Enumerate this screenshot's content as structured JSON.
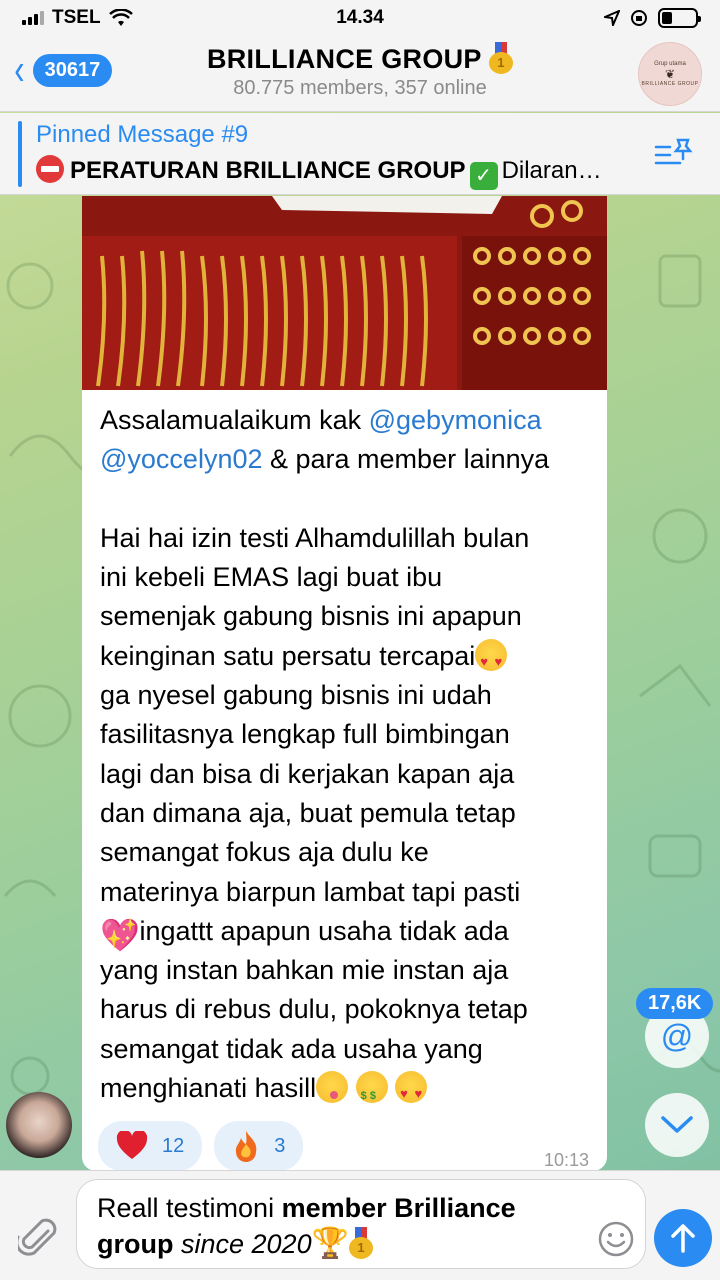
{
  "status_bar": {
    "carrier": "TSEL",
    "time": "14.34"
  },
  "header": {
    "back_badge": "30617",
    "title": "BRILLIANCE GROUP",
    "subtitle": "80.775 members, 357 online",
    "avatar_text_top": "Grup utama",
    "avatar_text_bottom": "BRILLIANCE GROUP"
  },
  "pinned": {
    "title": "Pinned Message #9",
    "text_bold": "PERATURAN BRILLIANCE GROUP",
    "text_rest": "Dilaran…"
  },
  "message": {
    "greeting": "Assalamualaikum kak ",
    "mention_1": "@gebymonica",
    "mention_2": "@yoccelyn02",
    "greeting_rest": " & para member lainnya",
    "body_1": "Hai hai izin testi Alhamdulillah bulan\nini kebeli EMAS lagi buat ibu\nsemenjak gabung bisnis ini apapun\nkeinginan satu persatu tercapai",
    "body_2": "ga nyesel gabung bisnis ini udah\nfasilitasnya lengkap full bimbingan\nlagi dan bisa di kerjakan kapan aja\ndan dimana aja, buat pemula tetap\nsemangat fokus aja dulu ke\nmaterinya biarpun lambat tapi pasti\n",
    "body_3": " ingattt apapun usaha tidak ada\nyang instan bahkan mie instan aja\nharus di rebus dulu, pokoknya tetap\nsemangat tidak ada usaha yang\nmenghianati hasill",
    "time": "10:13"
  },
  "reactions": [
    {
      "icon": "heart-icon",
      "count": "12"
    },
    {
      "icon": "fire-icon",
      "count": "3"
    }
  ],
  "floating": {
    "mention_count": "17,6K",
    "mention_symbol": "@"
  },
  "input": {
    "text_1": "Reall testimoni ",
    "text_bold": "member Brilliance",
    "text_bold_2": "group",
    "text_italic": " since 2020"
  },
  "colors": {
    "accent": "#2a8bf2",
    "mention": "#2a7ad0",
    "reaction_bg": "#e5f0fb"
  }
}
